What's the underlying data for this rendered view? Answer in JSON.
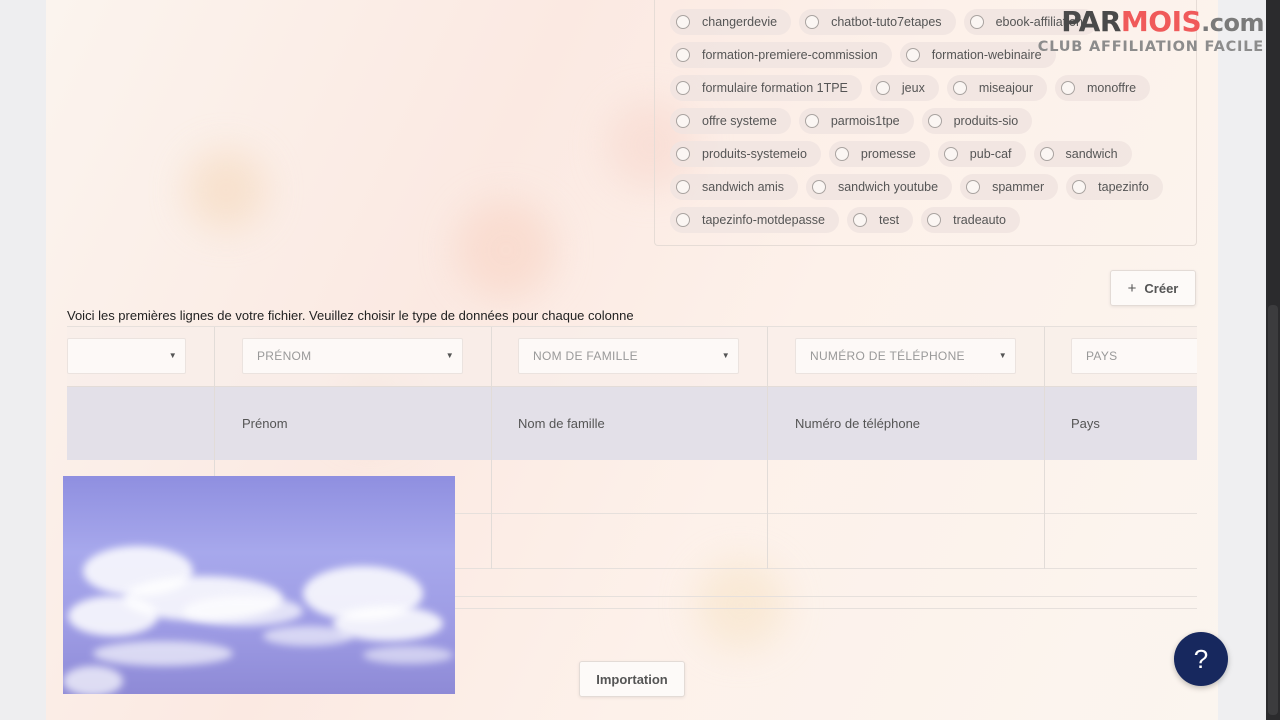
{
  "logo": {
    "part1": "PAR",
    "part2": "MOIS",
    "part3": ".com",
    "tagline": "CLUB AFFILIATION FACILE"
  },
  "tag_rows": [
    [
      "changerdevie",
      "chatbot-tuto7etapes",
      "ebook-affiliation"
    ],
    [
      "formation-premiere-commission",
      "formation-webinaire"
    ],
    [
      "formulaire formation 1TPE",
      "jeux",
      "miseajour",
      "monoffre"
    ],
    [
      "offre systeme",
      "parmois1tpe",
      "produits-sio"
    ],
    [
      "produits-systemeio",
      "promesse",
      "pub-caf",
      "sandwich"
    ],
    [
      "sandwich amis",
      "sandwich youtube",
      "spammer",
      "tapezinfo"
    ],
    [
      "tapezinfo-motdepasse",
      "test",
      "tradeauto"
    ]
  ],
  "create_button": {
    "icon": "+",
    "label": "Créer"
  },
  "instructions": "Voici les premières lignes de votre fichier. Veuillez choisir le type de données pour chaque colonne",
  "columns": [
    {
      "select": "",
      "header": ""
    },
    {
      "select": "PRÉNOM",
      "header": "Prénom"
    },
    {
      "select": "NOM DE FAMILLE",
      "header": "Nom de famille"
    },
    {
      "select": "NUMÉRO DE TÉLÉPHONE",
      "header": "Numéro de téléphone"
    },
    {
      "select": "PAYS",
      "header": "Pays"
    }
  ],
  "import_button": "Importation",
  "help_button": "?",
  "colors": {
    "help_bg": "#17285e",
    "logo_accent": "#f05a5a",
    "header_row": "#e3e0e8"
  }
}
